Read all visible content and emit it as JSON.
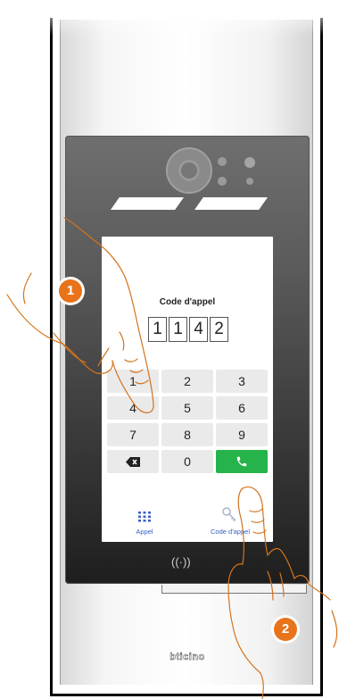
{
  "screen": {
    "title": "Code d'appel",
    "code_digits": [
      "1",
      "1",
      "4",
      "2"
    ],
    "keypad": [
      {
        "label": "1",
        "type": "digit"
      },
      {
        "label": "2",
        "type": "digit"
      },
      {
        "label": "3",
        "type": "digit"
      },
      {
        "label": "4",
        "type": "digit"
      },
      {
        "label": "5",
        "type": "digit"
      },
      {
        "label": "6",
        "type": "digit"
      },
      {
        "label": "7",
        "type": "digit"
      },
      {
        "label": "8",
        "type": "digit"
      },
      {
        "label": "9",
        "type": "digit"
      },
      {
        "label": "",
        "type": "backspace",
        "icon": "backspace-icon"
      },
      {
        "label": "0",
        "type": "digit"
      },
      {
        "label": "",
        "type": "call",
        "icon": "phone-icon"
      }
    ],
    "tabs": [
      {
        "label": "Appel",
        "icon": "grid-icon"
      },
      {
        "label": "Code d'appel",
        "icon": "key-icon"
      }
    ]
  },
  "device": {
    "nfc_symbol": "((·))",
    "brand": "bticino"
  },
  "markers": [
    "1",
    "2"
  ],
  "colors": {
    "call_button": "#27b34b",
    "marker": "#e8731a",
    "tab_accent": "#3a5fc8",
    "hand_outline": "#d4731c"
  }
}
